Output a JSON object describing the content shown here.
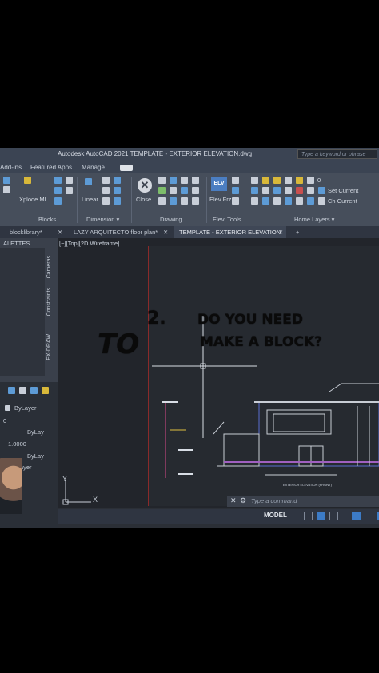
{
  "window": {
    "title": "Autodesk AutoCAD 2021    TEMPLATE - EXTERIOR ELEVATION.dwg",
    "search_placeholder": "Type a keyword or phrase"
  },
  "ribbon_tabs": [
    "Add-ins",
    "Featured Apps",
    "Manage"
  ],
  "ribbon": {
    "xplode_label": "Xplode ML",
    "linear_label": "Linear",
    "close_label": "Close",
    "elv_box": "ELV",
    "elv_frz_label": "Elev Frz",
    "layer_count": "0",
    "set_current": "Set Current",
    "ch_current": "Ch Current",
    "panels": [
      "Blocks",
      "Dimension ▾",
      "Drawing",
      "Elev. Tools",
      "Home Layers ▾"
    ]
  },
  "doc_tabs": [
    {
      "label": "blocklibrary*",
      "active": false
    },
    {
      "label": "LAZY ARQUITECTO floor plan*",
      "active": false
    },
    {
      "label": "TEMPLATE - EXTERIOR ELEVATION",
      "active": true
    }
  ],
  "add_tab_symbol": "+",
  "palettes": {
    "title": "ALETTES",
    "vertical_tabs": [
      "Cameras",
      "Constraints",
      "EX-DRAW"
    ],
    "properties": [
      "ByLayer",
      "0",
      "ByLay",
      "1.0000",
      "ByLay",
      "ByLayer"
    ]
  },
  "canvas": {
    "view_label": "[−][Top][2D Wireframe]",
    "caption_number": "2.",
    "caption_line1": "DO YOU NEED",
    "caption_big": "TO",
    "caption_line2": "MAKE A BLOCK?",
    "ucs_x": "X",
    "ucs_y": "Y",
    "footer_text": "EXTERIOR ELEVATION (FRONT)"
  },
  "command": {
    "placeholder": "Type a command"
  },
  "status": {
    "model_label": "MODEL"
  },
  "colors": {
    "accent": "#3c7bc6",
    "paper_border": "#8a2a2a"
  }
}
